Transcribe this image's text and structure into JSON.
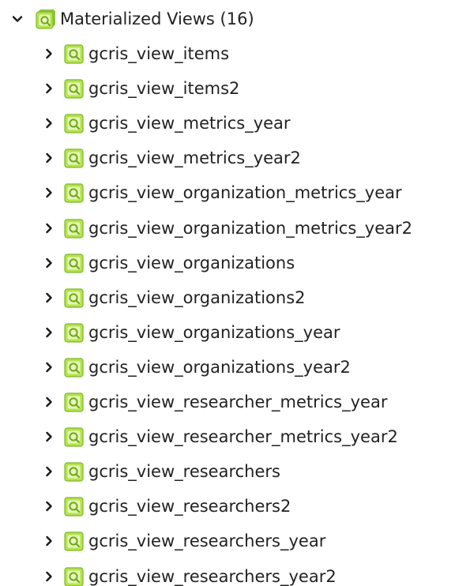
{
  "tree": {
    "root": {
      "label": "Materialized Views (16)",
      "expanded": true,
      "icon": "materialized-view-icon"
    },
    "items": [
      {
        "label": "gcris_view_items"
      },
      {
        "label": "gcris_view_items2"
      },
      {
        "label": "gcris_view_metrics_year"
      },
      {
        "label": "gcris_view_metrics_year2"
      },
      {
        "label": "gcris_view_organization_metrics_year"
      },
      {
        "label": "gcris_view_organization_metrics_year2"
      },
      {
        "label": "gcris_view_organizations"
      },
      {
        "label": "gcris_view_organizations2"
      },
      {
        "label": "gcris_view_organizations_year"
      },
      {
        "label": "gcris_view_organizations_year2"
      },
      {
        "label": "gcris_view_researcher_metrics_year"
      },
      {
        "label": "gcris_view_researcher_metrics_year2"
      },
      {
        "label": "gcris_view_researchers"
      },
      {
        "label": "gcris_view_researchers2"
      },
      {
        "label": "gcris_view_researchers_year"
      },
      {
        "label": "gcris_view_researchers_year2"
      }
    ]
  },
  "colors": {
    "icon_fill": "#b5e34a",
    "icon_dark": "#6fa820",
    "icon_light": "#e6f7b8",
    "text": "#222222",
    "caret": "#1a1a1a"
  }
}
